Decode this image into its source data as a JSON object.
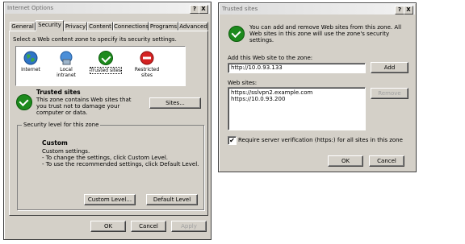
{
  "internet_options": {
    "title": "Internet Options",
    "title_buttons": {
      "help": "?",
      "close": "X"
    },
    "tabs": [
      "General",
      "Security",
      "Privacy",
      "Content",
      "Connections",
      "Programs",
      "Advanced"
    ],
    "active_tab": "Security",
    "zone_prompt": "Select a Web content zone to specify its security settings.",
    "zones": [
      {
        "label": "Internet",
        "icon": "globe-icon"
      },
      {
        "label": "Local intranet",
        "icon": "local-intranet-icon"
      },
      {
        "label": "Trusted sites",
        "icon": "trusted-sites-check-icon"
      },
      {
        "label": "Restricted sites",
        "icon": "restricted-sites-icon"
      }
    ],
    "selected_zone": "Trusted sites",
    "zone_info": {
      "title": "Trusted sites",
      "description": "This zone contains Web sites that you trust not to damage your computer or data."
    },
    "sites_button": "Sites...",
    "security_level": {
      "legend": "Security level for this zone",
      "title": "Custom",
      "line1": "Custom settings.",
      "line2": "- To change the settings, click Custom Level.",
      "line3": "- To use the recommended settings, click Default Level."
    },
    "custom_level_button": "Custom Level...",
    "default_level_button": "Default Level",
    "ok": "OK",
    "cancel": "Cancel",
    "apply": "Apply"
  },
  "trusted_sites": {
    "title": "Trusted sites",
    "title_buttons": {
      "help": "?",
      "close": "X"
    },
    "description": "You can add and remove Web sites from this zone. All Web sites in this zone will use the zone's security settings.",
    "add_label": "Add this Web site to the zone:",
    "add_value": "http://10.0.93.133",
    "add_button": "Add",
    "websites_label": "Web sites:",
    "websites": [
      "https://sslvpn2.example.com",
      "https://10.0.93.200"
    ],
    "remove_button": "Remove",
    "require_verification_checked": true,
    "require_verification": "Require server verification (https:) for all sites in this zone",
    "ok": "OK",
    "cancel": "Cancel"
  }
}
